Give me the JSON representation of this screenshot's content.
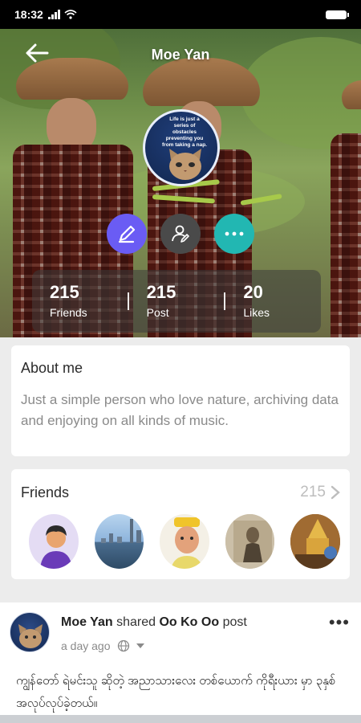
{
  "status": {
    "time": "18:32"
  },
  "header": {
    "title": "Moe Yan"
  },
  "avatar": {
    "quote": "Life is just a series of obstacles preventing you from taking a nap."
  },
  "stats": [
    {
      "value": "215",
      "label": "Friends"
    },
    {
      "value": "215",
      "label": "Post"
    },
    {
      "value": "20",
      "label": "Likes"
    }
  ],
  "about": {
    "title": "About me",
    "text": "Just a simple person who love nature, archiving data and enjoying on all kinds of music."
  },
  "friends": {
    "title": "Friends",
    "count": "215",
    "items": [
      {
        "icon": "person-avatar"
      },
      {
        "icon": "city-skyline-photo"
      },
      {
        "icon": "child-photo"
      },
      {
        "icon": "vintage-photo"
      },
      {
        "icon": "temple-photo"
      }
    ]
  },
  "post": {
    "author": "Moe Yan",
    "action": "shared",
    "target": "Oo Ko Oo",
    "target_suffix": "post",
    "time": "a day ago",
    "body": "ကျွန်တော် ရဲမင်းသူ ဆိုတဲ့ အညာသားလေး တစ်ယောက် ကိုရီးယား မှာ ၃နှစ် အလုပ်လုပ်ခဲ့တယ်။"
  },
  "colors": {
    "edit": "#6a5cf4",
    "user": "#4a4a4a",
    "more": "#22b7b2"
  }
}
